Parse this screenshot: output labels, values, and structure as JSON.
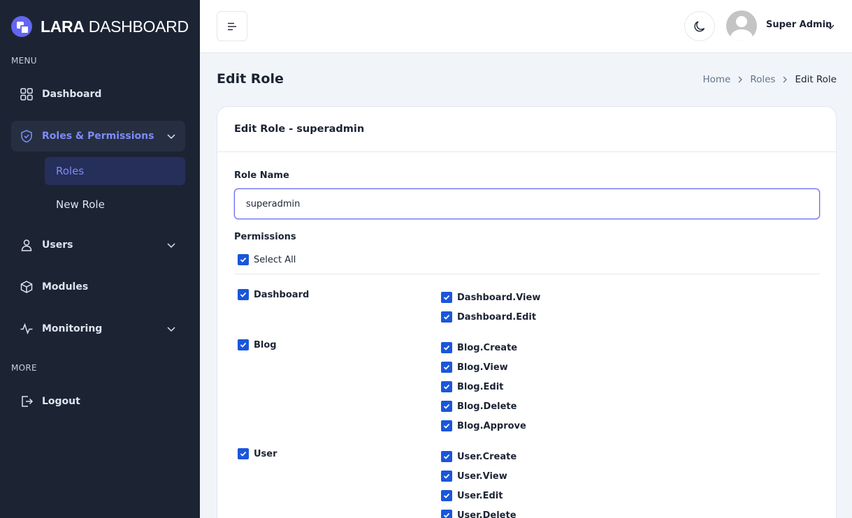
{
  "brand": {
    "name_bold": "LARA",
    "name_light": "DASHBOARD"
  },
  "sidebar": {
    "menu_label": "MENU",
    "more_label": "MORE",
    "items": [
      {
        "label": "Dashboard",
        "icon": "grid-icon"
      },
      {
        "label": "Roles & Permissions",
        "icon": "shield-icon",
        "expanded": true,
        "children": [
          {
            "label": "Roles",
            "active": true
          },
          {
            "label": "New Role"
          }
        ]
      },
      {
        "label": "Users",
        "icon": "user-icon"
      },
      {
        "label": "Modules",
        "icon": "cube-icon"
      },
      {
        "label": "Monitoring",
        "icon": "activity-icon"
      }
    ],
    "more_items": [
      {
        "label": "Logout",
        "icon": "logout-icon"
      }
    ]
  },
  "header": {
    "user_name": "Super Admin"
  },
  "page": {
    "title": "Edit Role",
    "breadcrumb": [
      "Home",
      "Roles",
      "Edit Role"
    ]
  },
  "card": {
    "title": "Edit Role - superadmin",
    "role_name_label": "Role Name",
    "role_name_value": "superadmin",
    "permissions_label": "Permissions",
    "select_all_label": "Select All",
    "groups": [
      {
        "name": "Dashboard",
        "permissions": [
          "Dashboard.View",
          "Dashboard.Edit"
        ]
      },
      {
        "name": "Blog",
        "permissions": [
          "Blog.Create",
          "Blog.View",
          "Blog.Edit",
          "Blog.Delete",
          "Blog.Approve"
        ]
      },
      {
        "name": "User",
        "permissions": [
          "User.Create",
          "User.View",
          "User.Edit",
          "User.Delete"
        ]
      }
    ]
  },
  "colors": {
    "sidebar_bg": "#1c2434",
    "accent": "#7d8cf5",
    "checkbox": "#1a56db"
  }
}
